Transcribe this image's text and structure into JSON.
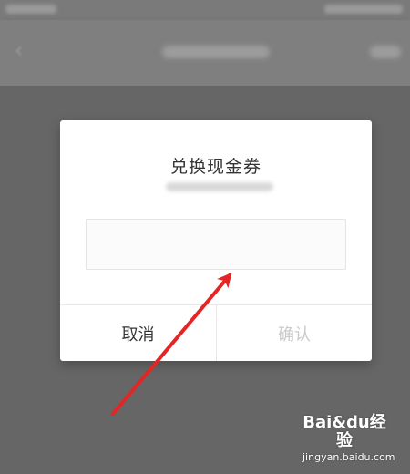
{
  "dialog": {
    "title": "兑换现金券",
    "input_placeholder": "",
    "input_value": "",
    "cancel_label": "取消",
    "confirm_label": "确认"
  },
  "watermark": {
    "brand_line": "Bai&du经验",
    "domain_line": "jingyan.baidu.com"
  },
  "colors": {
    "overlay": "#666666",
    "dialog_bg": "#ffffff",
    "title_text": "#333333",
    "disabled_text": "#c9c9c9",
    "arrow_red": "#e52525"
  },
  "icons": {
    "back": "back-arrow-icon",
    "annotation": "red-arrow-icon"
  }
}
